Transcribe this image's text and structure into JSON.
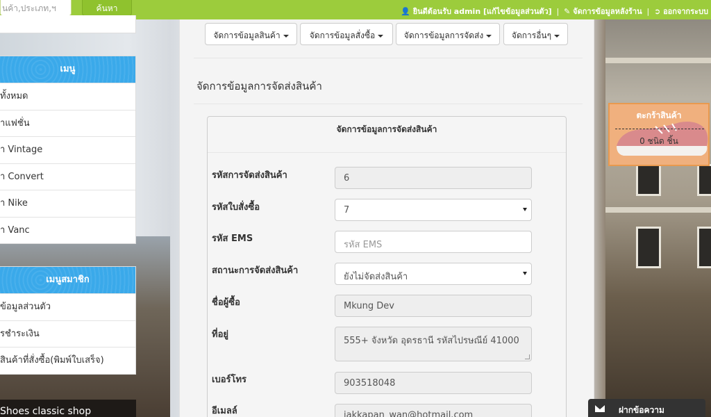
{
  "topbar": {
    "search_placeholder": "นค้า,ประเภท,ฯ",
    "search_button": "ค้นหา",
    "welcome": "ยินดีต้อนรับ admin [แก้ไขข้อมูลส่วนตัว]",
    "backend": "จัดการข้อมูลหลังร้าน",
    "logout": "ออกจากระบบ",
    "separator": "|"
  },
  "sidebar": {
    "menu_title": "เมนู",
    "items": [
      "ทั้งหมด",
      "าแฟชั่น",
      "า Vintage",
      "า Convert",
      "า Nike",
      "า Vanc"
    ],
    "member_title": "เมนูสมาชิก",
    "member_items": [
      "ข้อมูลส่วนตัว",
      "รชำระเงิน",
      "สินค้าที่สั่งซื้อ(พิมพ์ใบเสร็จ)"
    ],
    "shop_banner": "Shoes classic shop"
  },
  "nav": {
    "products": "จัดการข้อมูลสินค้า",
    "orders": "จัดการข้อมูลสั่งซื้อ",
    "shipping": "จัดการข้อมูลการจัดส่ง",
    "others": "จัดการอื่นๆ"
  },
  "page_title": "จัดการข้อมูลการจัดส่งสินค้า",
  "form": {
    "heading": "จัดการข้อมูลการจัดส่งสินค้า",
    "shipping_id_label": "รหัสการจัดส่งสินค้า",
    "shipping_id_value": "6",
    "order_id_label": "รหัสใบสั่งซื้อ",
    "order_id_value": "7",
    "ems_label": "รหัส EMS",
    "ems_placeholder": "รหัส EMS",
    "status_label": "สถานะการจัดส่งสินค้า",
    "status_value": "ยังไม่จัดส่งสินค้า",
    "buyer_label": "ชื่อผู้ซื้อ",
    "buyer_value": "Mkung Dev",
    "address_label": "ที่อยู่",
    "address_value": "555+  จังหวัด อุดรธานี  รหัสไปรษณีย์ 41000",
    "phone_label": "เบอร์โทร",
    "phone_value": "903518048",
    "email_label": "อีเมลล์",
    "email_value": "jakkapan_wan@hotmail.com"
  },
  "cart": {
    "title": "ตะกร้าสินค้า",
    "count": "0 ชนิด ชิ้น"
  },
  "message_tab": {
    "label": "ฝากข้อความ"
  },
  "colors": {
    "topbar": "#9ccc3c",
    "sidebar_header": "#3aa9ea",
    "cart": "#f0b07e"
  }
}
